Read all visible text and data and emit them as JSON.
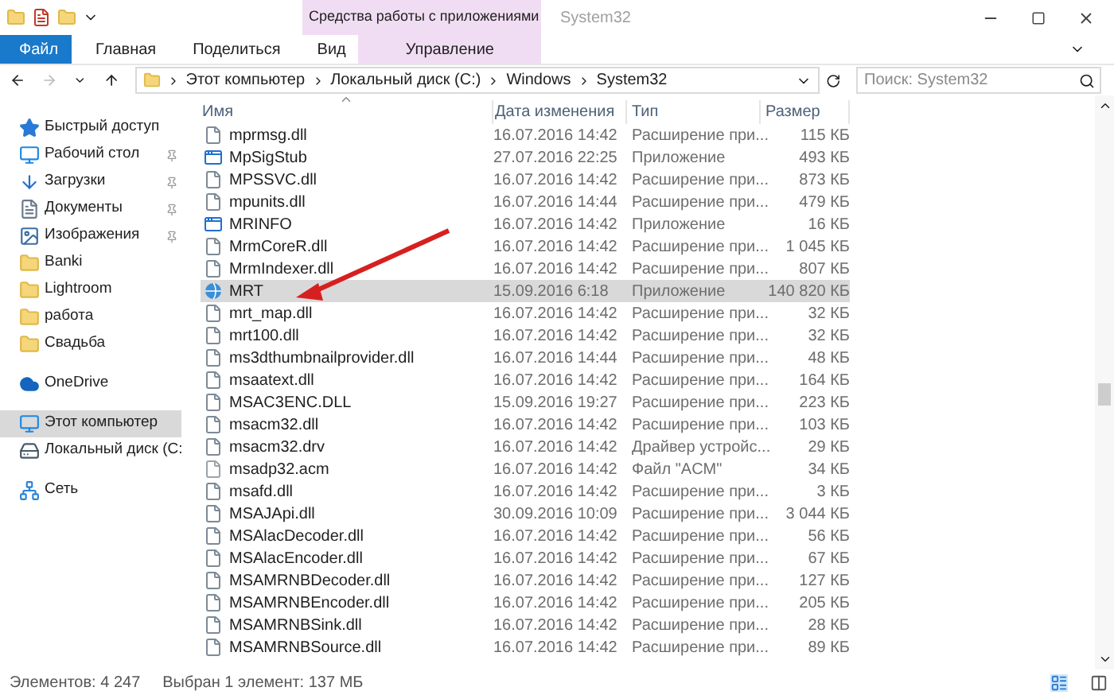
{
  "window": {
    "contextual_tab": "Средства работы с приложениями",
    "title": "System32"
  },
  "ribbon_tabs": [
    {
      "label": "Файл",
      "kind": "file"
    },
    {
      "label": "Главная",
      "kind": "tab"
    },
    {
      "label": "Поделиться",
      "kind": "tab"
    },
    {
      "label": "Вид",
      "kind": "tab"
    },
    {
      "label": "Управление",
      "kind": "context"
    }
  ],
  "address": {
    "crumbs": [
      "Этот компьютер",
      "Локальный диск (C:)",
      "Windows",
      "System32"
    ]
  },
  "search": {
    "placeholder": "Поиск: System32"
  },
  "sidebar": {
    "groups": [
      {
        "items": [
          {
            "label": "Быстрый доступ",
            "kind": "star",
            "pinned": false,
            "selected": false
          },
          {
            "label": "Рабочий стол",
            "kind": "desktop",
            "pinned": true,
            "selected": false
          },
          {
            "label": "Загрузки",
            "kind": "download",
            "pinned": true,
            "selected": false
          },
          {
            "label": "Документы",
            "kind": "docs",
            "pinned": true,
            "selected": false
          },
          {
            "label": "Изображения",
            "kind": "pictures",
            "pinned": true,
            "selected": false
          },
          {
            "label": "Banki",
            "kind": "folder",
            "pinned": false,
            "selected": false
          },
          {
            "label": "Lightroom",
            "kind": "folder",
            "pinned": false,
            "selected": false
          },
          {
            "label": "работа",
            "kind": "folder",
            "pinned": false,
            "selected": false
          },
          {
            "label": "Свадьба",
            "kind": "folder",
            "pinned": false,
            "selected": false
          }
        ]
      },
      {
        "items": [
          {
            "label": "OneDrive",
            "kind": "cloud",
            "pinned": false,
            "selected": false
          }
        ]
      },
      {
        "items": [
          {
            "label": "Этот компьютер",
            "kind": "computer",
            "pinned": false,
            "selected": true
          },
          {
            "label": "Локальный диск (C:",
            "kind": "drive",
            "pinned": false,
            "selected": false
          }
        ]
      },
      {
        "items": [
          {
            "label": "Сеть",
            "kind": "network",
            "pinned": false,
            "selected": false
          }
        ]
      }
    ]
  },
  "table": {
    "columns": [
      "Имя",
      "Дата изменения",
      "Тип",
      "Размер"
    ],
    "rows": [
      {
        "name": "mprmsg.dll",
        "date": "16.07.2016 14:42",
        "type": "Расширение при...",
        "size": "115 КБ",
        "kind": "dll",
        "selected": false
      },
      {
        "name": "MpSigStub",
        "date": "27.07.2016 22:25",
        "type": "Приложение",
        "size": "493 КБ",
        "kind": "app",
        "selected": false
      },
      {
        "name": "MPSSVC.dll",
        "date": "16.07.2016 14:42",
        "type": "Расширение при...",
        "size": "873 КБ",
        "kind": "dll",
        "selected": false
      },
      {
        "name": "mpunits.dll",
        "date": "16.07.2016 14:44",
        "type": "Расширение при...",
        "size": "479 КБ",
        "kind": "dll",
        "selected": false
      },
      {
        "name": "MRINFO",
        "date": "16.07.2016 14:42",
        "type": "Приложение",
        "size": "16 КБ",
        "kind": "app",
        "selected": false
      },
      {
        "name": "MrmCoreR.dll",
        "date": "16.07.2016 14:42",
        "type": "Расширение при...",
        "size": "1 045 КБ",
        "kind": "dll",
        "selected": false
      },
      {
        "name": "MrmIndexer.dll",
        "date": "16.07.2016 14:42",
        "type": "Расширение при...",
        "size": "807 КБ",
        "kind": "dll",
        "selected": false
      },
      {
        "name": "MRT",
        "date": "15.09.2016 6:18",
        "type": "Приложение",
        "size": "140 820 КБ",
        "kind": "tool",
        "selected": true
      },
      {
        "name": "mrt_map.dll",
        "date": "16.07.2016 14:42",
        "type": "Расширение при...",
        "size": "32 КБ",
        "kind": "dll",
        "selected": false
      },
      {
        "name": "mrt100.dll",
        "date": "16.07.2016 14:42",
        "type": "Расширение при...",
        "size": "32 КБ",
        "kind": "dll",
        "selected": false
      },
      {
        "name": "ms3dthumbnailprovider.dll",
        "date": "16.07.2016 14:44",
        "type": "Расширение при...",
        "size": "48 КБ",
        "kind": "dll",
        "selected": false
      },
      {
        "name": "msaatext.dll",
        "date": "16.07.2016 14:42",
        "type": "Расширение при...",
        "size": "164 КБ",
        "kind": "dll",
        "selected": false
      },
      {
        "name": "MSAC3ENC.DLL",
        "date": "15.09.2016 19:27",
        "type": "Расширение при...",
        "size": "223 КБ",
        "kind": "dll",
        "selected": false
      },
      {
        "name": "msacm32.dll",
        "date": "16.07.2016 14:42",
        "type": "Расширение при...",
        "size": "103 КБ",
        "kind": "dll",
        "selected": false
      },
      {
        "name": "msacm32.drv",
        "date": "16.07.2016 14:42",
        "type": "Драйвер устройс...",
        "size": "29 КБ",
        "kind": "dll",
        "selected": false
      },
      {
        "name": "msadp32.acm",
        "date": "16.07.2016 14:42",
        "type": "Файл \"ACM\"",
        "size": "34 КБ",
        "kind": "file",
        "selected": false
      },
      {
        "name": "msafd.dll",
        "date": "16.07.2016 14:42",
        "type": "Расширение при...",
        "size": "3 КБ",
        "kind": "dll",
        "selected": false
      },
      {
        "name": "MSAJApi.dll",
        "date": "30.09.2016 10:09",
        "type": "Расширение при...",
        "size": "3 044 КБ",
        "kind": "dll",
        "selected": false
      },
      {
        "name": "MSAlacDecoder.dll",
        "date": "16.07.2016 14:42",
        "type": "Расширение при...",
        "size": "56 КБ",
        "kind": "dll",
        "selected": false
      },
      {
        "name": "MSAlacEncoder.dll",
        "date": "16.07.2016 14:42",
        "type": "Расширение при...",
        "size": "67 КБ",
        "kind": "dll",
        "selected": false
      },
      {
        "name": "MSAMRNBDecoder.dll",
        "date": "16.07.2016 14:42",
        "type": "Расширение при...",
        "size": "127 КБ",
        "kind": "dll",
        "selected": false
      },
      {
        "name": "MSAMRNBEncoder.dll",
        "date": "16.07.2016 14:42",
        "type": "Расширение при...",
        "size": "205 КБ",
        "kind": "dll",
        "selected": false
      },
      {
        "name": "MSAMRNBSink.dll",
        "date": "16.07.2016 14:42",
        "type": "Расширение при...",
        "size": "28 КБ",
        "kind": "dll",
        "selected": false
      },
      {
        "name": "MSAMRNBSource.dll",
        "date": "16.07.2016 14:42",
        "type": "Расширение при...",
        "size": "89 КБ",
        "kind": "dll",
        "selected": false
      }
    ]
  },
  "status_bar": {
    "count": "Элементов: 4 247",
    "selection": "Выбран 1 элемент: 137 МБ"
  }
}
